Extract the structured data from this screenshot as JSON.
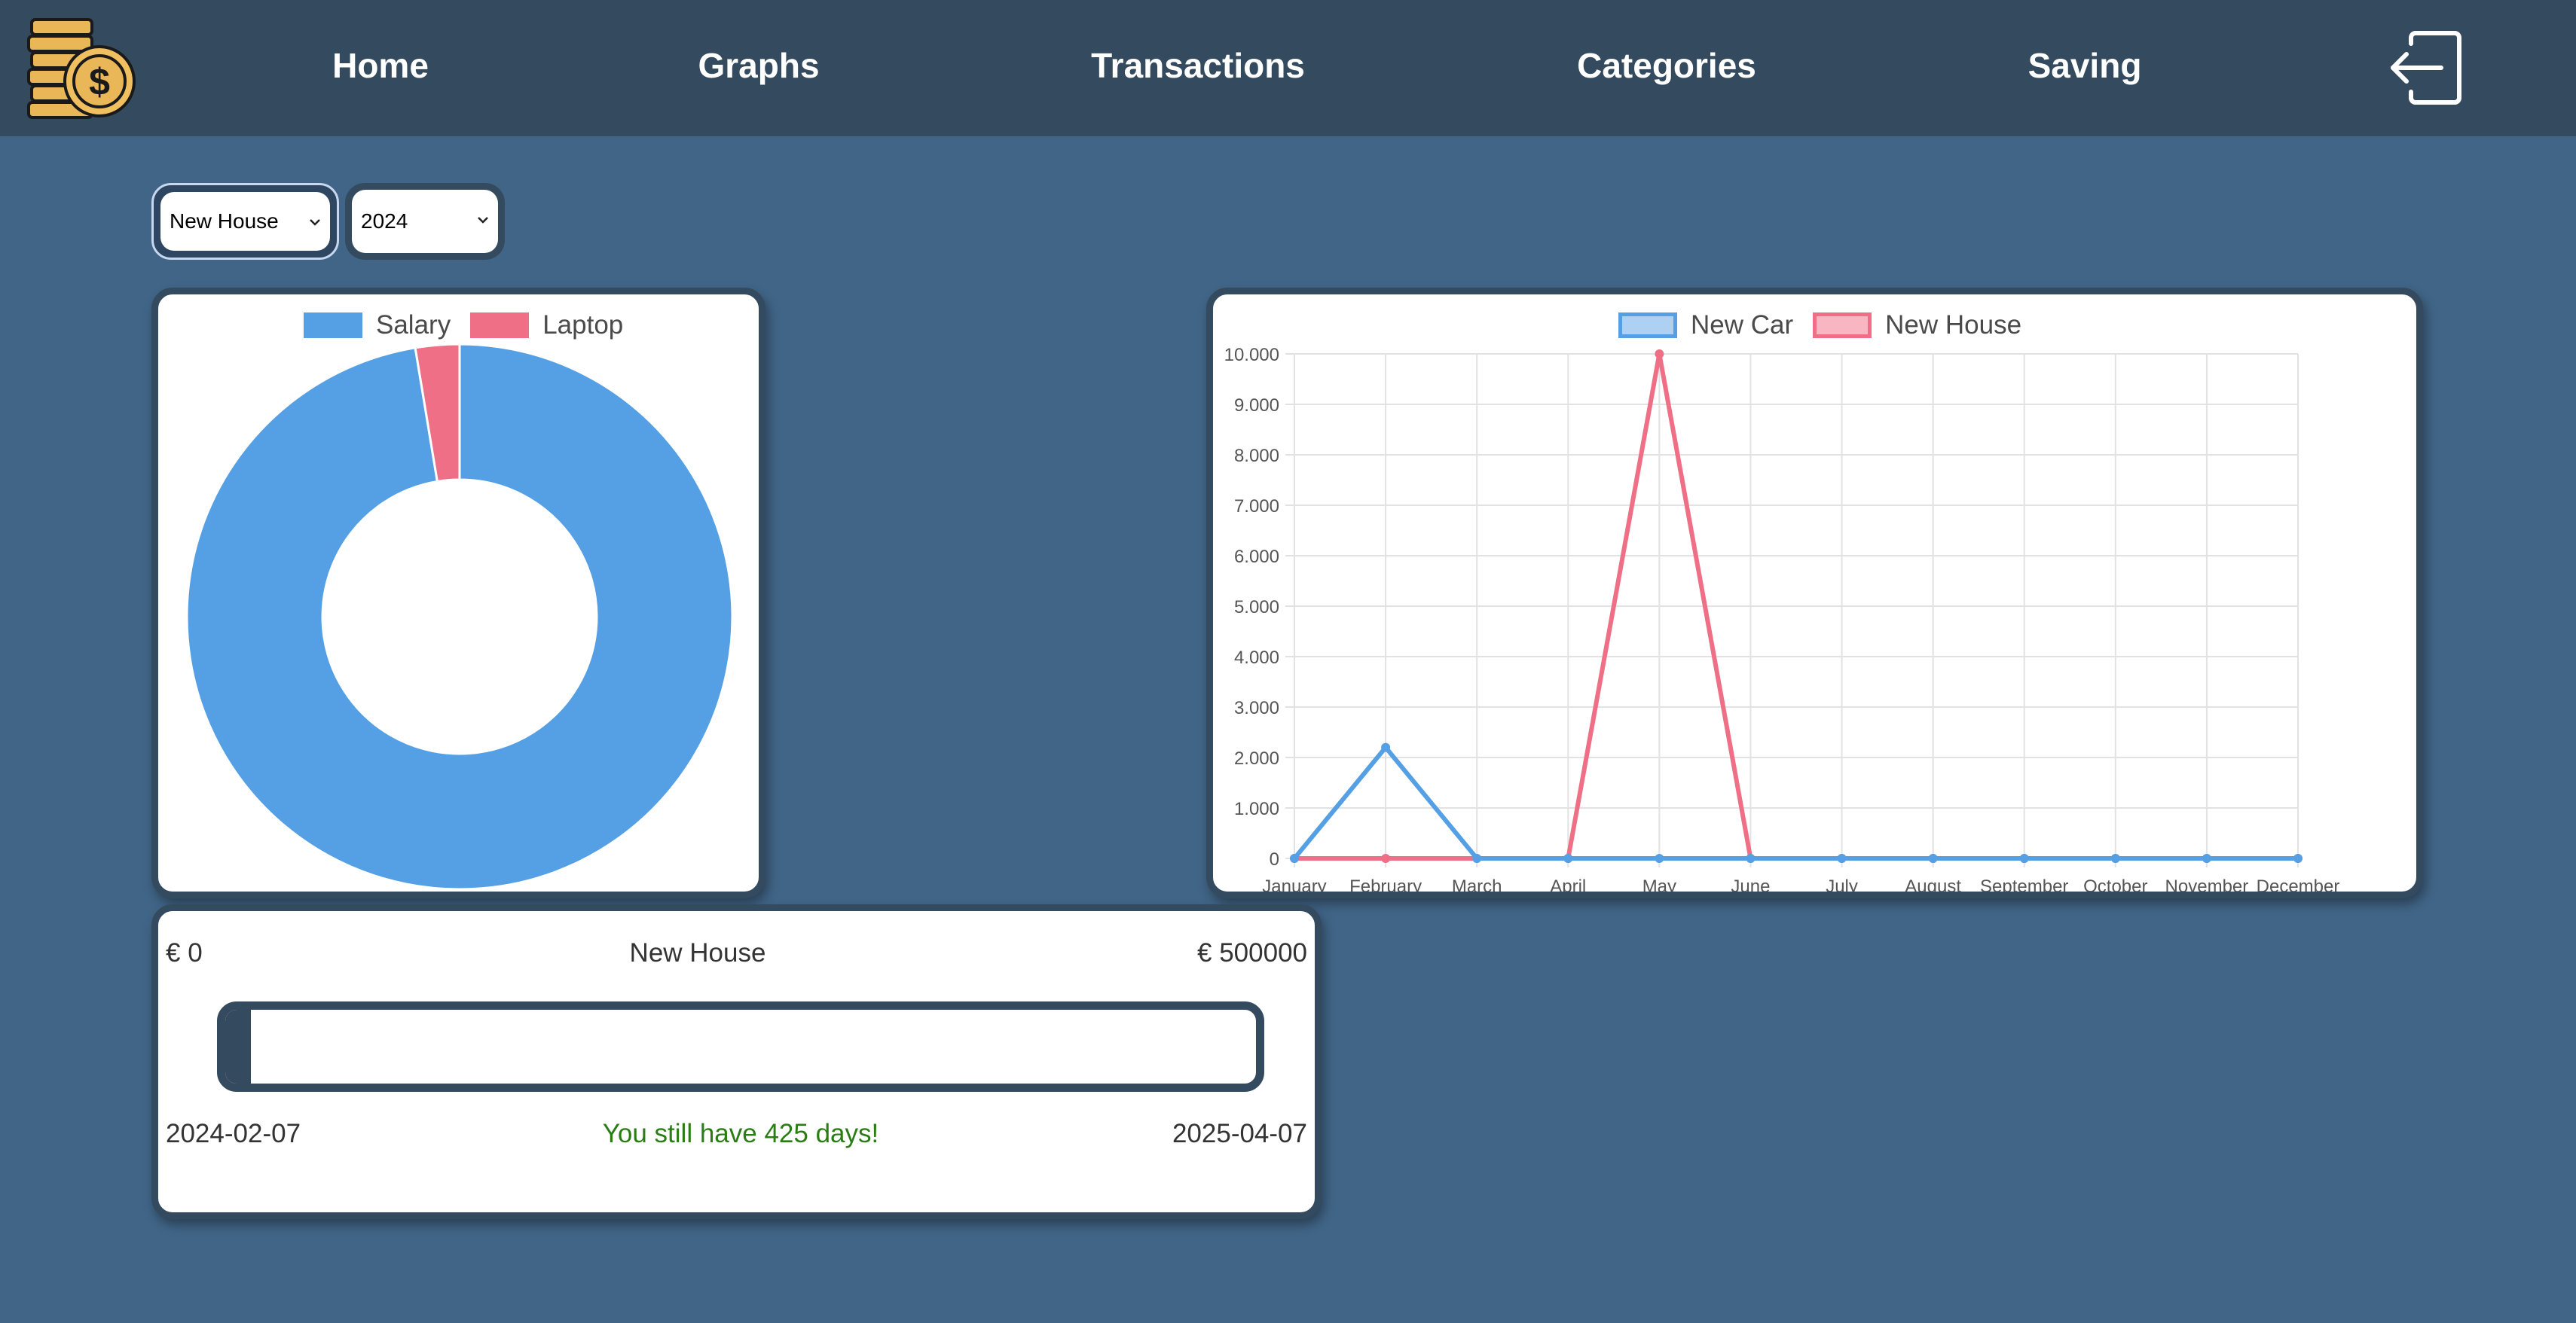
{
  "nav": {
    "items": [
      "Home",
      "Graphs",
      "Transactions",
      "Categories",
      "Saving"
    ],
    "logo_icon": "coins-dollar-icon",
    "logout_icon": "logout-icon"
  },
  "filters": {
    "saving_goal": "New House",
    "year": "2024"
  },
  "colors": {
    "background": "#416587",
    "navbar": "#344a5e",
    "blue": "#55a0e4",
    "pink": "#ef6f86",
    "green": "#2a7d14"
  },
  "donut": {
    "legend": [
      "Salary",
      "Laptop"
    ],
    "chart_data": {
      "type": "pie",
      "categories": [
        "Salary",
        "Laptop"
      ],
      "values": [
        97.4,
        2.6
      ],
      "colors": [
        "#55a0e4",
        "#ef6f86"
      ],
      "legend": "top"
    }
  },
  "line": {
    "legend": [
      "New Car",
      "New House"
    ],
    "chart_data": {
      "type": "line",
      "categories": [
        "January",
        "February",
        "March",
        "April",
        "May",
        "June",
        "July",
        "August",
        "September",
        "October",
        "November",
        "December"
      ],
      "series": [
        {
          "name": "New Car",
          "color": "#55a0e4",
          "values": [
            0,
            2200,
            0,
            0,
            0,
            0,
            0,
            0,
            0,
            0,
            0,
            0
          ]
        },
        {
          "name": "New House",
          "color": "#ef6f86",
          "values": [
            0,
            0,
            0,
            0,
            10000,
            0,
            0,
            0,
            0,
            0,
            0,
            0
          ]
        }
      ],
      "yticks": [
        "0",
        "1.000",
        "2.000",
        "3.000",
        "4.000",
        "5.000",
        "6.000",
        "7.000",
        "8.000",
        "9.000",
        "10.000"
      ],
      "ylim": [
        0,
        10000
      ],
      "grid": true,
      "legend": "top"
    }
  },
  "saving": {
    "min": "€ 0",
    "name": "New House",
    "max": "€ 500000",
    "progress": 0.01,
    "start_date": "2024-02-07",
    "message": "You still have 425 days!",
    "end_date": "2025-04-07"
  }
}
